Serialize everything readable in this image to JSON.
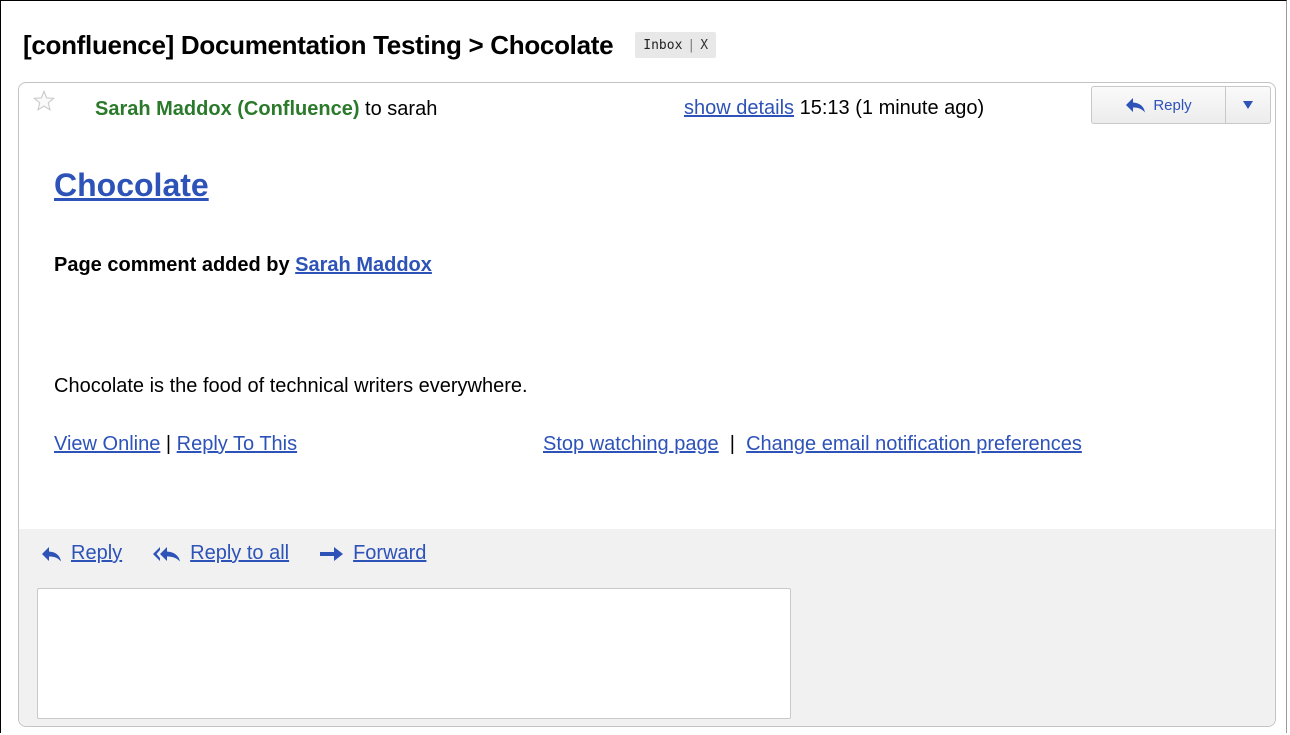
{
  "thread": {
    "subject": "[confluence] Documentation Testing > Chocolate",
    "label": "Inbox",
    "label_separator": "|",
    "label_remove": "X"
  },
  "message": {
    "sender_name": "Sarah Maddox (Confluence)",
    "to_text": "to sarah",
    "show_details": "show details",
    "timestamp": "15:13 (1 minute ago)",
    "reply_button_label": "Reply",
    "icons": {
      "star": "star-icon",
      "reply": "reply-arrow-icon",
      "more": "dropdown-triangle-icon"
    }
  },
  "body": {
    "page_title": "Chocolate",
    "comment_prefix": "Page comment added by ",
    "comment_author": "Sarah Maddox",
    "comment_text": "Chocolate is the food of technical writers everywhere.",
    "view_online": "View Online",
    "link_separator": " | ",
    "reply_to_this": "Reply To This",
    "stop_watching": "Stop watching page",
    "right_separator": "  |  ",
    "change_prefs": "Change email notification preferences"
  },
  "reply_area": {
    "reply": "Reply",
    "reply_all": "Reply to all",
    "forward": "Forward",
    "icons": {
      "reply": "reply-arrow-icon",
      "reply_all": "reply-all-arrow-icon",
      "forward": "forward-arrow-icon"
    }
  },
  "colors": {
    "link": "#2d52b8",
    "sender": "#2b7a2b",
    "reply_area_bg": "#f1f1f1",
    "chip_bg": "#e8e8e8"
  }
}
